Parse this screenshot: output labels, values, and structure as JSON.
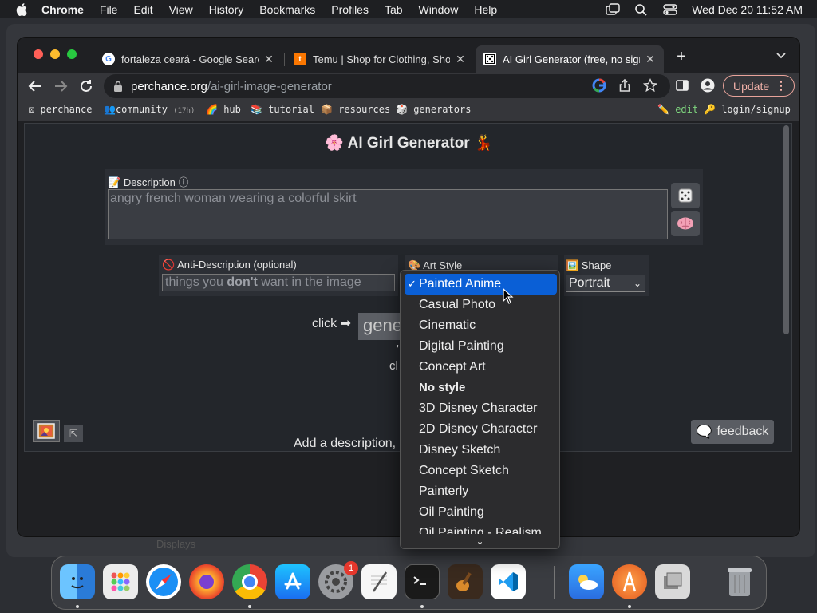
{
  "menubar": {
    "app": "Chrome",
    "items": [
      "File",
      "Edit",
      "View",
      "History",
      "Bookmarks",
      "Profiles",
      "Tab",
      "Window",
      "Help"
    ],
    "clock": "Wed Dec 20  11:52 AM"
  },
  "background": {
    "ghost_item": "Displays"
  },
  "tabs": [
    {
      "title": "fortaleza ceará - Google Search",
      "icon": "google-favicon"
    },
    {
      "title": "Temu | Shop for Clothing, Shoes",
      "icon": "temu-favicon"
    },
    {
      "title": "AI Girl Generator (free, no sign",
      "icon": "perchance-favicon",
      "active": true
    }
  ],
  "omnibox": {
    "host": "perchance.org",
    "path": "/ai-girl-image-generator"
  },
  "update_label": "Update",
  "bookmarks": {
    "perchance": "perchance",
    "community": "community",
    "community_count": "(17h)",
    "hub": "hub",
    "tutorial": "tutorial",
    "resources": "resources",
    "generators": "generators",
    "edit": "edit",
    "login": "login/signup"
  },
  "page": {
    "title": "AI Girl Generator",
    "description_label": "Description",
    "description_placeholder": "angry french woman wearing a colorful skirt",
    "anti_label": "Anti-Description (optional)",
    "anti_placeholder_pre": "things you ",
    "anti_placeholder_bold": "don't",
    "anti_placeholder_post": " want in the image",
    "art_style_label": "Art Style",
    "shape_label": "Shape",
    "shape_value": "Portrait",
    "click_text": "click ➡",
    "generate_partial": "gene",
    "frag_1": "'",
    "frag_2": "cl",
    "hint_text": "Add a description, ",
    "feedback_label": "feedback"
  },
  "dropdown": {
    "selected": "Painted Anime",
    "options": [
      {
        "label": "Painted Anime",
        "selected": true
      },
      {
        "label": "Casual Photo"
      },
      {
        "label": "Cinematic"
      },
      {
        "label": "Digital Painting"
      },
      {
        "label": "Concept Art"
      },
      {
        "label": "No style",
        "bold": true
      },
      {
        "label": "3D Disney Character"
      },
      {
        "label": "2D Disney Character"
      },
      {
        "label": "Disney Sketch"
      },
      {
        "label": "Concept Sketch"
      },
      {
        "label": "Painterly"
      },
      {
        "label": "Oil Painting"
      },
      {
        "label": "Oil Painting - Realism"
      }
    ],
    "more_indicator": "⌄"
  },
  "dock": {
    "apps": [
      "Finder",
      "Launchpad",
      "Safari",
      "Firefox",
      "Chrome",
      "App Store",
      "System Preferences",
      "TextEdit",
      "Terminal",
      "GarageBand",
      "Visual Studio Code",
      "Weather",
      "Instruments",
      "Preview",
      "Trash"
    ],
    "settings_badge": "1"
  },
  "colors": {
    "accent": "#0a5fd6",
    "update_border": "#e8a39a"
  }
}
